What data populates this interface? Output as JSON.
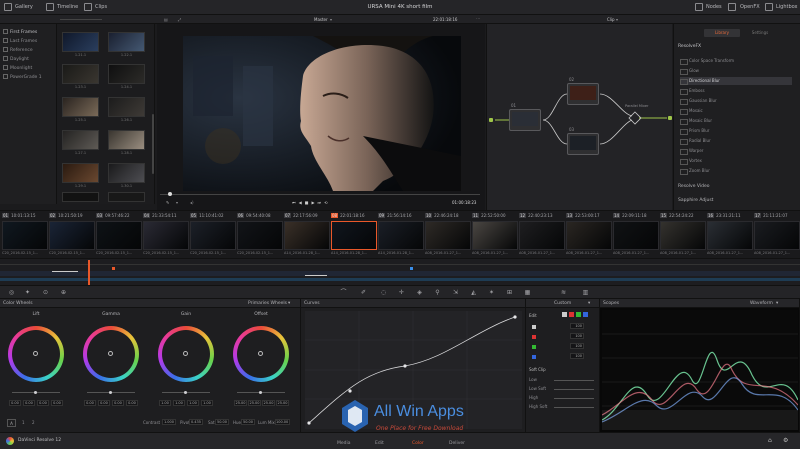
{
  "topbar": {
    "gallery": "Gallery",
    "timeline": "Timeline",
    "clips": "Clips",
    "title": "URSA Mini 4K short film",
    "nodes": "Nodes",
    "openfx": "OpenFX",
    "lightbox": "Lightbox"
  },
  "viewer": {
    "name": "Master",
    "timecode_top": "22:01:18:16",
    "timecode_bottom": "01:00:18:23",
    "clip_menu": "Clip"
  },
  "leftnav": [
    "First Frames",
    "Last Frames",
    "Reference",
    "Daylight",
    "Moonlight",
    "PowerGrade 1"
  ],
  "gallery_labels": [
    "1.21.1",
    "1.22.1",
    "1.23.1",
    "1.24.1",
    "1.25.1",
    "1.26.1",
    "1.27.1",
    "1.28.1",
    "1.29.1",
    "1.30.1",
    "1.31.1",
    "1.32.1"
  ],
  "nodes": {
    "parallel_mixer": "Parallel Mixer",
    "labels": [
      "01",
      "02",
      "03",
      "04"
    ]
  },
  "library": {
    "tabs": [
      "Library",
      "Settings"
    ],
    "heading": "ResolveFX",
    "items": [
      "Color Space Transform",
      "Glow",
      "Directional Blur",
      "Emboss",
      "Gaussian Blur",
      "Mosaic",
      "Mosaic Blur",
      "Prism Blur",
      "Radial Blur",
      "Warper",
      "Vortex",
      "Zoom Blur"
    ],
    "footer1": "Resolve Video",
    "footer2": "Sapphire Adjust"
  },
  "clips": [
    {
      "n": "01",
      "tc": "10:01:13:15",
      "lab": "C20_2016-02-15_1..."
    },
    {
      "n": "02",
      "tc": "10:21:50:19",
      "lab": "C20_2016-02-15_1..."
    },
    {
      "n": "03",
      "tc": "09:57:46:22",
      "lab": "C20_2016-02-15_1..."
    },
    {
      "n": "04",
      "tc": "21:33:54:11",
      "lab": "C20_2016-02-15_1..."
    },
    {
      "n": "05",
      "tc": "11:10:41:02",
      "lab": "C20_2016-02-15_1..."
    },
    {
      "n": "06",
      "tc": "09:54:40:08",
      "lab": "C20_2016-02-15_1..."
    },
    {
      "n": "07",
      "tc": "22:17:56:09",
      "lab": "A14_2016-01-28_1..."
    },
    {
      "n": "08",
      "tc": "22:01:18:16",
      "lab": "A14_2016-01-28_1..."
    },
    {
      "n": "09",
      "tc": "21:56:14:16",
      "lab": "A14_2016-01-28_1..."
    },
    {
      "n": "10",
      "tc": "22:46:24:18",
      "lab": "A08_2016-01-27_1..."
    },
    {
      "n": "11",
      "tc": "22:52:50:00",
      "lab": "A08_2016-01-27_1..."
    },
    {
      "n": "12",
      "tc": "22:40:23:13",
      "lab": "A08_2016-01-27_1..."
    },
    {
      "n": "13",
      "tc": "22:53:00:17",
      "lab": "A08_2016-01-27_1..."
    },
    {
      "n": "14",
      "tc": "22:09:11:18",
      "lab": "A08_2016-01-27_1..."
    },
    {
      "n": "15",
      "tc": "22:54:24:22",
      "lab": "A08_2016-01-27_1..."
    },
    {
      "n": "16",
      "tc": "23:31:21:11",
      "lab": "A08_2016-01-27_1..."
    },
    {
      "n": "17",
      "tc": "21:11:21:07",
      "lab": "A08_2016-01-27_1..."
    },
    {
      "n": "18",
      "tc": "20:44:10:09",
      "lab": "A08_2016-01-27_1..."
    }
  ],
  "color_wheels": {
    "title": "Color Wheels",
    "mode": "Primaries Wheels",
    "wheels": [
      {
        "name": "Lift",
        "vals": [
          "0.00",
          "0.00",
          "0.00",
          "0.00"
        ]
      },
      {
        "name": "Gamma",
        "vals": [
          "0.00",
          "0.00",
          "0.00",
          "0.00"
        ]
      },
      {
        "name": "Gain",
        "vals": [
          "1.00",
          "1.00",
          "1.00",
          "1.00"
        ]
      },
      {
        "name": "Offset",
        "vals": [
          "25.00",
          "25.00",
          "25.00",
          "25.00"
        ]
      }
    ],
    "bottom": {
      "contrast": "Contrast",
      "contrast_v": "1.000",
      "pivot": "Pivot",
      "pivot_v": "0.435",
      "sat": "Sat",
      "sat_v": "50.00",
      "hue": "Hue",
      "hue_v": "50.00",
      "lum_mix": "Lum Mix",
      "lum_mix_v": "100.00"
    }
  },
  "curves": {
    "title": "Curves",
    "custom": "Custom",
    "edit": "Edit",
    "edit_vals": [
      "100",
      "100",
      "100",
      "100"
    ],
    "soft_clip": "Soft Clip",
    "soft_rows": [
      "Low",
      "Low Soft",
      "High",
      "High Soft"
    ]
  },
  "scopes": {
    "title": "Scopes",
    "mode": "Waveform"
  },
  "bottombar": {
    "app": "DaVinci Resolve 12",
    "pages": [
      "Media",
      "Edit",
      "Color",
      "Deliver"
    ]
  },
  "watermark": {
    "title": "All Win Apps",
    "sub": "One Place for Free Download"
  },
  "colors": {
    "accent": "#e9582a",
    "node_port": "#9fc64a",
    "panel": "#1e1e20"
  }
}
